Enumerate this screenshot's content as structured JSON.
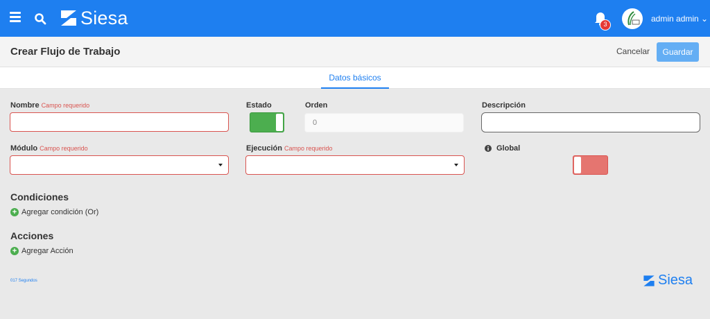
{
  "topbar": {
    "menu_icon": "hamburger-menu-icon",
    "search_icon": "search-icon",
    "brand": "Siesa",
    "notifications_count": "3",
    "user_name": "admin admin",
    "user_caret": "⌄"
  },
  "header": {
    "title": "Crear Flujo de Trabajo",
    "cancel_label": "Cancelar",
    "save_label": "Guardar"
  },
  "tabs": [
    {
      "label": "Datos básicos",
      "active": true
    }
  ],
  "form": {
    "nombre": {
      "label": "Nombre",
      "required": "Campo requerido",
      "value": ""
    },
    "estado": {
      "label": "Estado",
      "value": true
    },
    "orden": {
      "label": "Orden",
      "value": "0"
    },
    "descripcion": {
      "label": "Descripción",
      "value": ""
    },
    "modulo": {
      "label": "Módulo",
      "required": "Campo requerido",
      "value": ""
    },
    "ejecucion": {
      "label": "Ejecución",
      "required": "Campo requerido",
      "value": ""
    },
    "global": {
      "label": "Global",
      "value": false
    }
  },
  "conditions": {
    "title": "Condiciones",
    "add_label": "Agregar condición (Or)"
  },
  "actions": {
    "title": "Acciones",
    "add_label": "Agregar Acción"
  },
  "footer": {
    "timing": "017 Segundos",
    "brand": "Siesa"
  },
  "colors": {
    "primary": "#1e7ff0",
    "required": "#d9534f",
    "toggle_on": "#4cae4f",
    "toggle_off": "#e57570"
  }
}
